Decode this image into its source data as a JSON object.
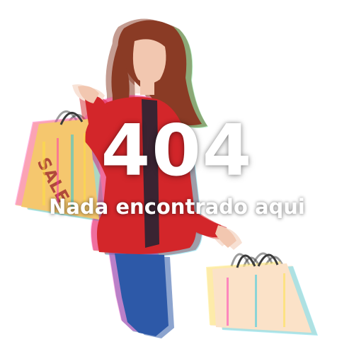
{
  "error": {
    "code": "404",
    "message": "Nada encontrado aqui"
  },
  "illustration": {
    "subject": "woman-shopping-glitch",
    "bag_text": "SALE"
  },
  "colors": {
    "background": "#ffffff",
    "text": "#ffffff",
    "jacket": "#d3262a",
    "jeans": "#2d59a8",
    "hair": "#8a3b25",
    "skin": "#f2c7b0",
    "bag_left": "#f5c76e",
    "bag_right": "#fbe2c8",
    "glitch_cyan": "#1ec8e6",
    "glitch_magenta": "#ff2fb4",
    "glitch_yellow": "#ffe23c"
  }
}
